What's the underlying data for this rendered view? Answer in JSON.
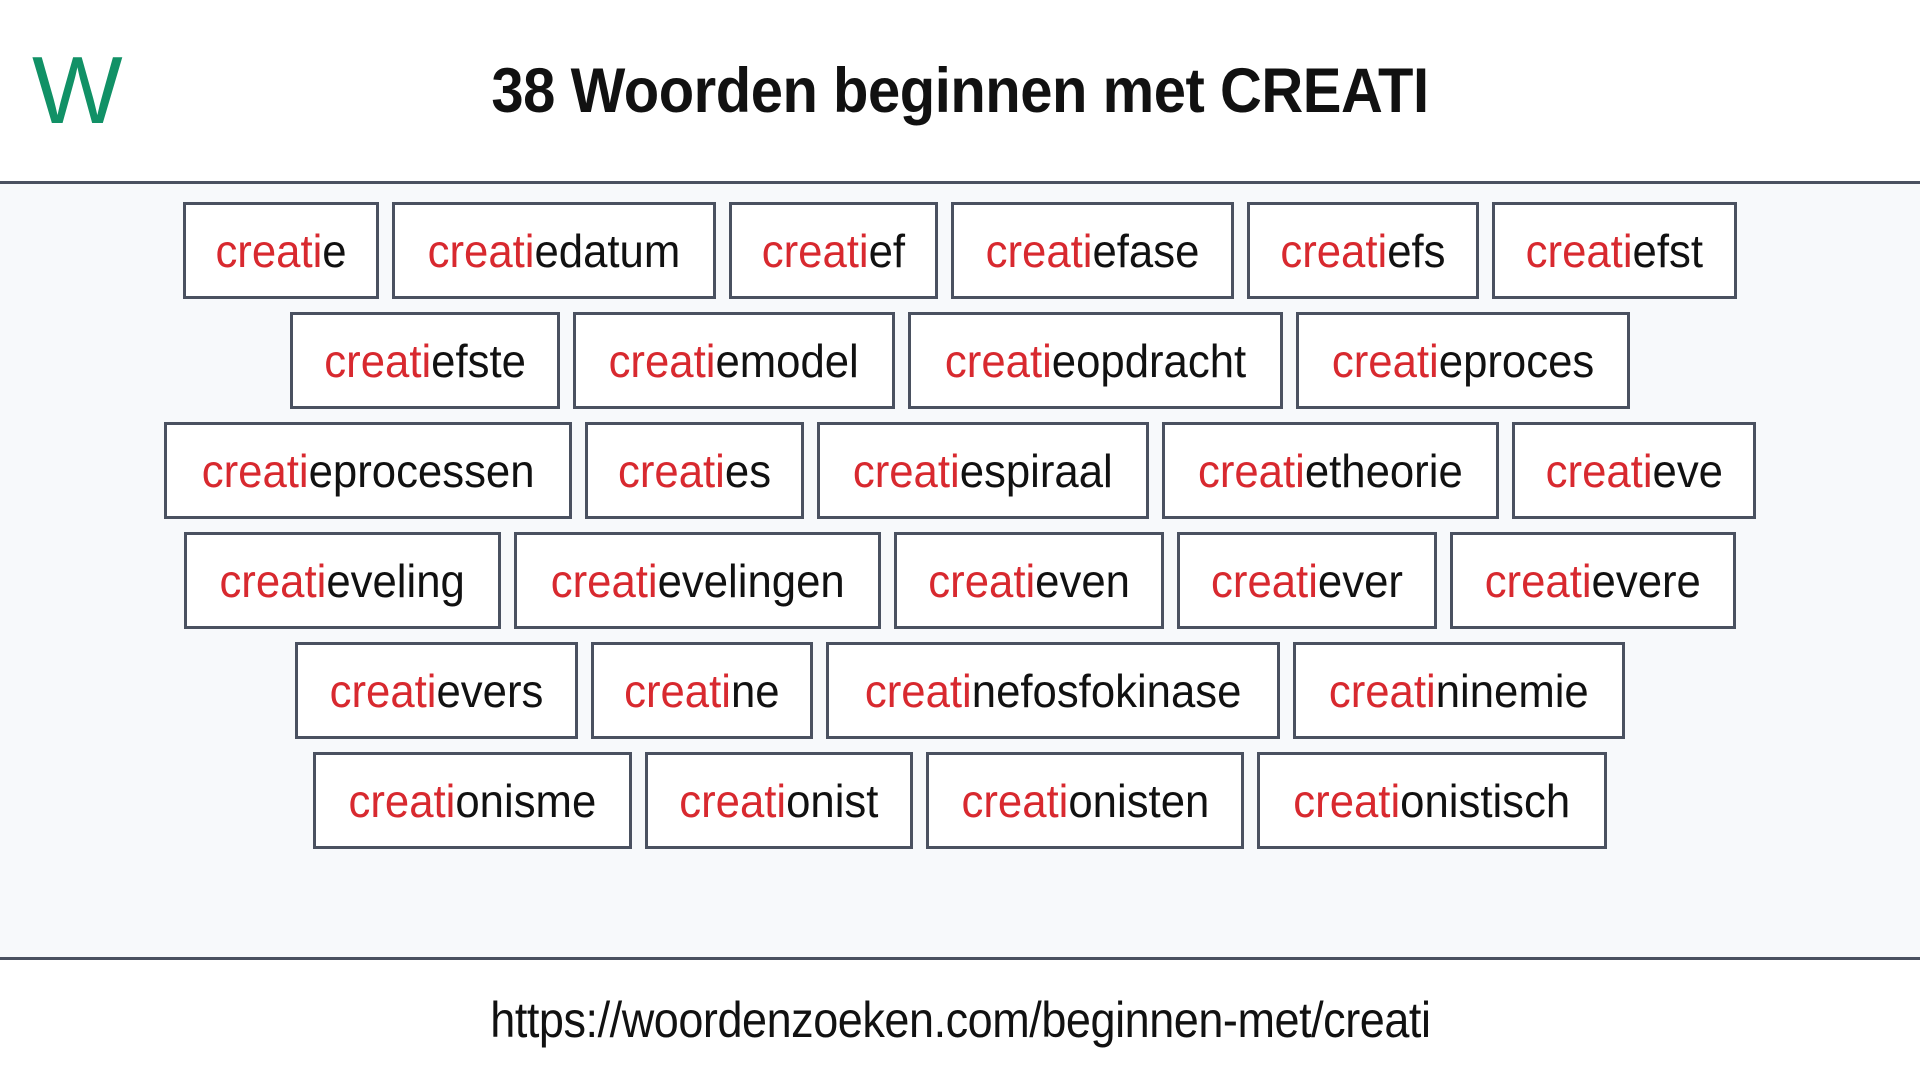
{
  "header": {
    "logo_text": "W",
    "logo_color": "#119166",
    "title": "38 Woorden beginnen met CREATI"
  },
  "highlight": {
    "prefix_color": "#d8292f",
    "text_color": "#111111",
    "box_border_color": "#4a5160",
    "background_color": "#f7f9fb"
  },
  "rows": [
    [
      {
        "prefix": "creati",
        "suffix": "e"
      },
      {
        "prefix": "creati",
        "suffix": "edatum"
      },
      {
        "prefix": "creati",
        "suffix": "ef"
      },
      {
        "prefix": "creati",
        "suffix": "efase"
      },
      {
        "prefix": "creati",
        "suffix": "efs"
      },
      {
        "prefix": "creati",
        "suffix": "efst"
      }
    ],
    [
      {
        "prefix": "creati",
        "suffix": "efste"
      },
      {
        "prefix": "creati",
        "suffix": "emodel"
      },
      {
        "prefix": "creati",
        "suffix": "eopdracht"
      },
      {
        "prefix": "creati",
        "suffix": "eproces"
      }
    ],
    [
      {
        "prefix": "creati",
        "suffix": "eprocessen"
      },
      {
        "prefix": "creati",
        "suffix": "es"
      },
      {
        "prefix": "creati",
        "suffix": "espiraal"
      },
      {
        "prefix": "creati",
        "suffix": "etheorie"
      },
      {
        "prefix": "creati",
        "suffix": "eve"
      }
    ],
    [
      {
        "prefix": "creati",
        "suffix": "eveling"
      },
      {
        "prefix": "creati",
        "suffix": "evelingen"
      },
      {
        "prefix": "creati",
        "suffix": "even"
      },
      {
        "prefix": "creati",
        "suffix": "ever"
      },
      {
        "prefix": "creati",
        "suffix": "evere"
      }
    ],
    [
      {
        "prefix": "creati",
        "suffix": "evers"
      },
      {
        "prefix": "creati",
        "suffix": "ne"
      },
      {
        "prefix": "creati",
        "suffix": "nefosfokinase"
      },
      {
        "prefix": "creati",
        "suffix": "ninemie"
      }
    ],
    [
      {
        "prefix": "creati",
        "suffix": "onisme"
      },
      {
        "prefix": "creati",
        "suffix": "onist"
      },
      {
        "prefix": "creati",
        "suffix": "onisten"
      },
      {
        "prefix": "creati",
        "suffix": "onistisch"
      }
    ]
  ],
  "footer": {
    "url": "https://woordenzoeken.com/beginnen-met/creati"
  }
}
